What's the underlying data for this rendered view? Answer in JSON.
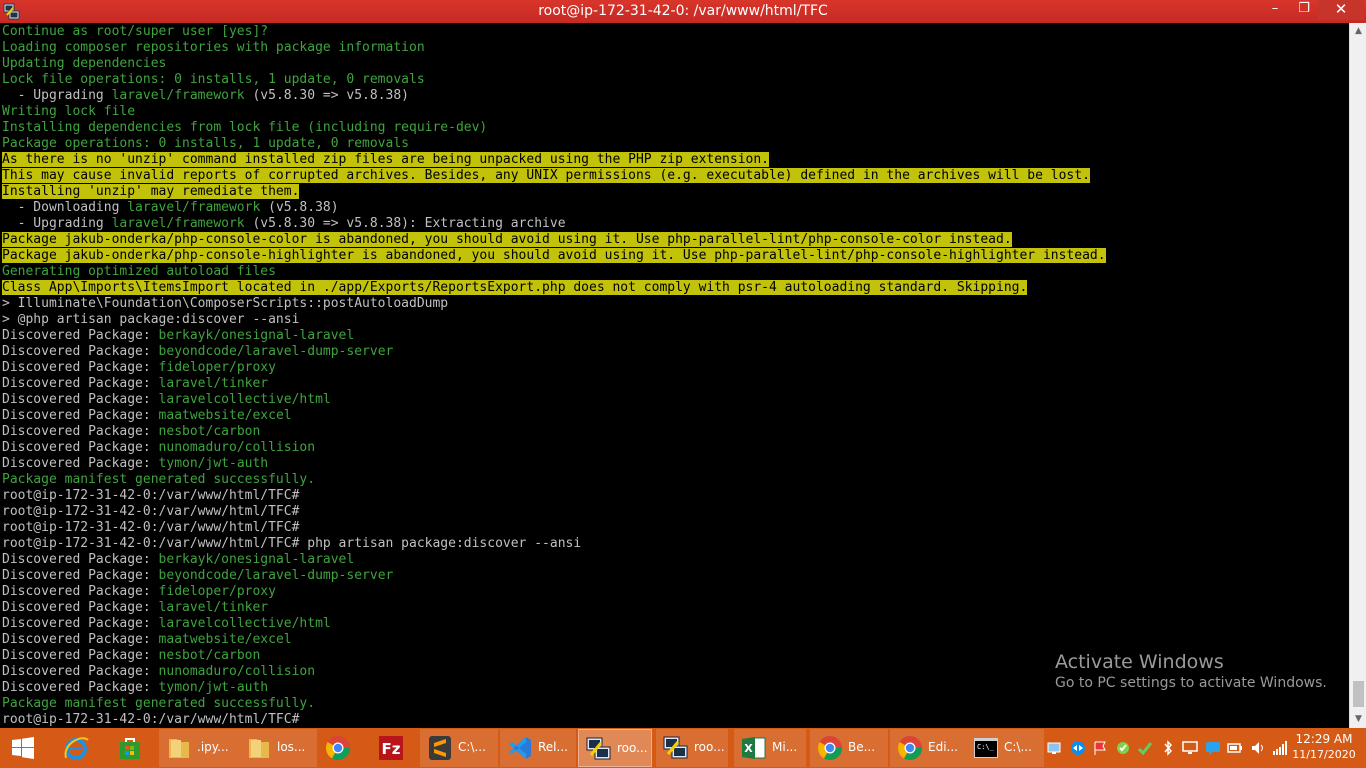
{
  "window": {
    "title": "root@ip-172-31-42-0: /var/www/html/TFC",
    "minimize": "–",
    "maximize": "❐",
    "close": "✕"
  },
  "terminal": {
    "lines": [
      {
        "text": "Continue as root/super user [yes]?",
        "style": "green"
      },
      {
        "text": "Loading composer repositories with package information",
        "style": "green"
      },
      {
        "text": "Updating dependencies",
        "style": "green"
      },
      {
        "text": "Lock file operations: 0 installs, 1 update, 0 removals",
        "style": "green"
      },
      {
        "text": "  - Upgrading ",
        "style": "normal",
        "pkg": "laravel/framework",
        "after": " (v5.8.30 => v5.8.38)"
      },
      {
        "text": "Writing lock file",
        "style": "green"
      },
      {
        "text": "Installing dependencies from lock file (including require-dev)",
        "style": "green"
      },
      {
        "text": "Package operations: 0 installs, 1 update, 0 removals",
        "style": "green"
      },
      {
        "text": "As there is no 'unzip' command installed zip files are being unpacked using the PHP zip extension.",
        "style": "hl"
      },
      {
        "text": "This may cause invalid reports of corrupted archives. Besides, any UNIX permissions (e.g. executable) defined in the archives will be lost.",
        "style": "hl"
      },
      {
        "text": "Installing 'unzip' may remediate them.",
        "style": "hl"
      },
      {
        "text": "  - Downloading ",
        "style": "normal",
        "pkg": "laravel/framework",
        "after": " (v5.8.38)"
      },
      {
        "text": "  - Upgrading ",
        "style": "normal",
        "pkg": "laravel/framework",
        "after": " (v5.8.30 => v5.8.38): Extracting archive"
      },
      {
        "text": "Package jakub-onderka/php-console-color is abandoned, you should avoid using it. Use php-parallel-lint/php-console-color instead.",
        "style": "hl"
      },
      {
        "text": "Package jakub-onderka/php-console-highlighter is abandoned, you should avoid using it. Use php-parallel-lint/php-console-highlighter instead.",
        "style": "hl"
      },
      {
        "text": "Generating optimized autoload files",
        "style": "green"
      },
      {
        "text": "Class App\\Imports\\ItemsImport located in ./app/Exports/ReportsExport.php does not comply with psr-4 autoloading standard. Skipping.",
        "style": "hl"
      },
      {
        "text": "> Illuminate\\Foundation\\ComposerScripts::postAutoloadDump",
        "style": "normal"
      },
      {
        "text": "> @php artisan package:discover --ansi",
        "style": "normal"
      },
      {
        "text": "Discovered Package: ",
        "style": "normal",
        "pkg": "berkayk/onesignal-laravel",
        "after": ""
      },
      {
        "text": "Discovered Package: ",
        "style": "normal",
        "pkg": "beyondcode/laravel-dump-server",
        "after": ""
      },
      {
        "text": "Discovered Package: ",
        "style": "normal",
        "pkg": "fideloper/proxy",
        "after": ""
      },
      {
        "text": "Discovered Package: ",
        "style": "normal",
        "pkg": "laravel/tinker",
        "after": ""
      },
      {
        "text": "Discovered Package: ",
        "style": "normal",
        "pkg": "laravelcollective/html",
        "after": ""
      },
      {
        "text": "Discovered Package: ",
        "style": "normal",
        "pkg": "maatwebsite/excel",
        "after": ""
      },
      {
        "text": "Discovered Package: ",
        "style": "normal",
        "pkg": "nesbot/carbon",
        "after": ""
      },
      {
        "text": "Discovered Package: ",
        "style": "normal",
        "pkg": "nunomaduro/collision",
        "after": ""
      },
      {
        "text": "Discovered Package: ",
        "style": "normal",
        "pkg": "tymon/jwt-auth",
        "after": ""
      },
      {
        "text": "Package manifest generated successfully.",
        "style": "green"
      },
      {
        "text": "root@ip-172-31-42-0:/var/www/html/TFC#",
        "style": "normal"
      },
      {
        "text": "root@ip-172-31-42-0:/var/www/html/TFC#",
        "style": "normal"
      },
      {
        "text": "root@ip-172-31-42-0:/var/www/html/TFC#",
        "style": "normal"
      },
      {
        "text": "root@ip-172-31-42-0:/var/www/html/TFC# php artisan package:discover --ansi",
        "style": "normal"
      },
      {
        "text": "Discovered Package: ",
        "style": "normal",
        "pkg": "berkayk/onesignal-laravel",
        "after": ""
      },
      {
        "text": "Discovered Package: ",
        "style": "normal",
        "pkg": "beyondcode/laravel-dump-server",
        "after": ""
      },
      {
        "text": "Discovered Package: ",
        "style": "normal",
        "pkg": "fideloper/proxy",
        "after": ""
      },
      {
        "text": "Discovered Package: ",
        "style": "normal",
        "pkg": "laravel/tinker",
        "after": ""
      },
      {
        "text": "Discovered Package: ",
        "style": "normal",
        "pkg": "laravelcollective/html",
        "after": ""
      },
      {
        "text": "Discovered Package: ",
        "style": "normal",
        "pkg": "maatwebsite/excel",
        "after": ""
      },
      {
        "text": "Discovered Package: ",
        "style": "normal",
        "pkg": "nesbot/carbon",
        "after": ""
      },
      {
        "text": "Discovered Package: ",
        "style": "normal",
        "pkg": "nunomaduro/collision",
        "after": ""
      },
      {
        "text": "Discovered Package: ",
        "style": "normal",
        "pkg": "tymon/jwt-auth",
        "after": ""
      },
      {
        "text": "Package manifest generated successfully.",
        "style": "green"
      },
      {
        "text": "root@ip-172-31-42-0:/var/www/html/TFC#",
        "style": "normal"
      }
    ]
  },
  "watermark": {
    "title": "Activate Windows",
    "subtitle": "Go to PC settings to activate Windows."
  },
  "taskbar": {
    "items": [
      {
        "name": "start-button",
        "label": "",
        "icon": "windows-logo-icon",
        "color": "#ffffff",
        "state": "none"
      },
      {
        "name": "taskbar-ie",
        "label": "",
        "icon": "internet-explorer-icon",
        "color": "#1e90e6",
        "state": "none"
      },
      {
        "name": "taskbar-store",
        "label": "",
        "icon": "store-icon",
        "color": "#2e9a2e",
        "state": "none"
      },
      {
        "name": "taskbar-folder-ipy",
        "label": ".ipy...",
        "icon": "folder-icon",
        "color": "#f2d27a",
        "state": "open"
      },
      {
        "name": "taskbar-folder-los",
        "label": "los...",
        "icon": "folder-icon",
        "color": "#f2d27a",
        "state": "open"
      },
      {
        "name": "taskbar-chrome-1",
        "label": "",
        "icon": "chrome-icon",
        "color": "#4285f4",
        "state": "none"
      },
      {
        "name": "taskbar-filezilla",
        "label": "",
        "icon": "filezilla-icon",
        "color": "#b8141b",
        "state": "none"
      },
      {
        "name": "taskbar-sublime",
        "label": "C:\\...",
        "icon": "sublime-text-icon",
        "color": "#3a3a3a",
        "state": "open"
      },
      {
        "name": "taskbar-vscode",
        "label": "Rel...",
        "icon": "vscode-icon",
        "color": "#2b7bd6",
        "state": "open"
      },
      {
        "name": "taskbar-putty-1",
        "label": "roo...",
        "icon": "putty-icon",
        "color": "#5c7fb8",
        "state": "active"
      },
      {
        "name": "taskbar-putty-2",
        "label": "roo...",
        "icon": "putty-icon",
        "color": "#5c7fb8",
        "state": "open"
      },
      {
        "name": "taskbar-excel",
        "label": "Mi...",
        "icon": "excel-icon",
        "color": "#1d7a43",
        "state": "open"
      },
      {
        "name": "taskbar-chrome-2",
        "label": "Be...",
        "icon": "chrome-icon",
        "color": "#4285f4",
        "state": "open"
      },
      {
        "name": "taskbar-chrome-3",
        "label": "Edi...",
        "icon": "chrome-icon",
        "color": "#4285f4",
        "state": "open"
      },
      {
        "name": "taskbar-cmd",
        "label": "C:\\...",
        "icon": "command-prompt-icon",
        "color": "#000000",
        "state": "open"
      }
    ],
    "clock": {
      "time": "12:29 AM",
      "date": "11/17/2020"
    }
  }
}
